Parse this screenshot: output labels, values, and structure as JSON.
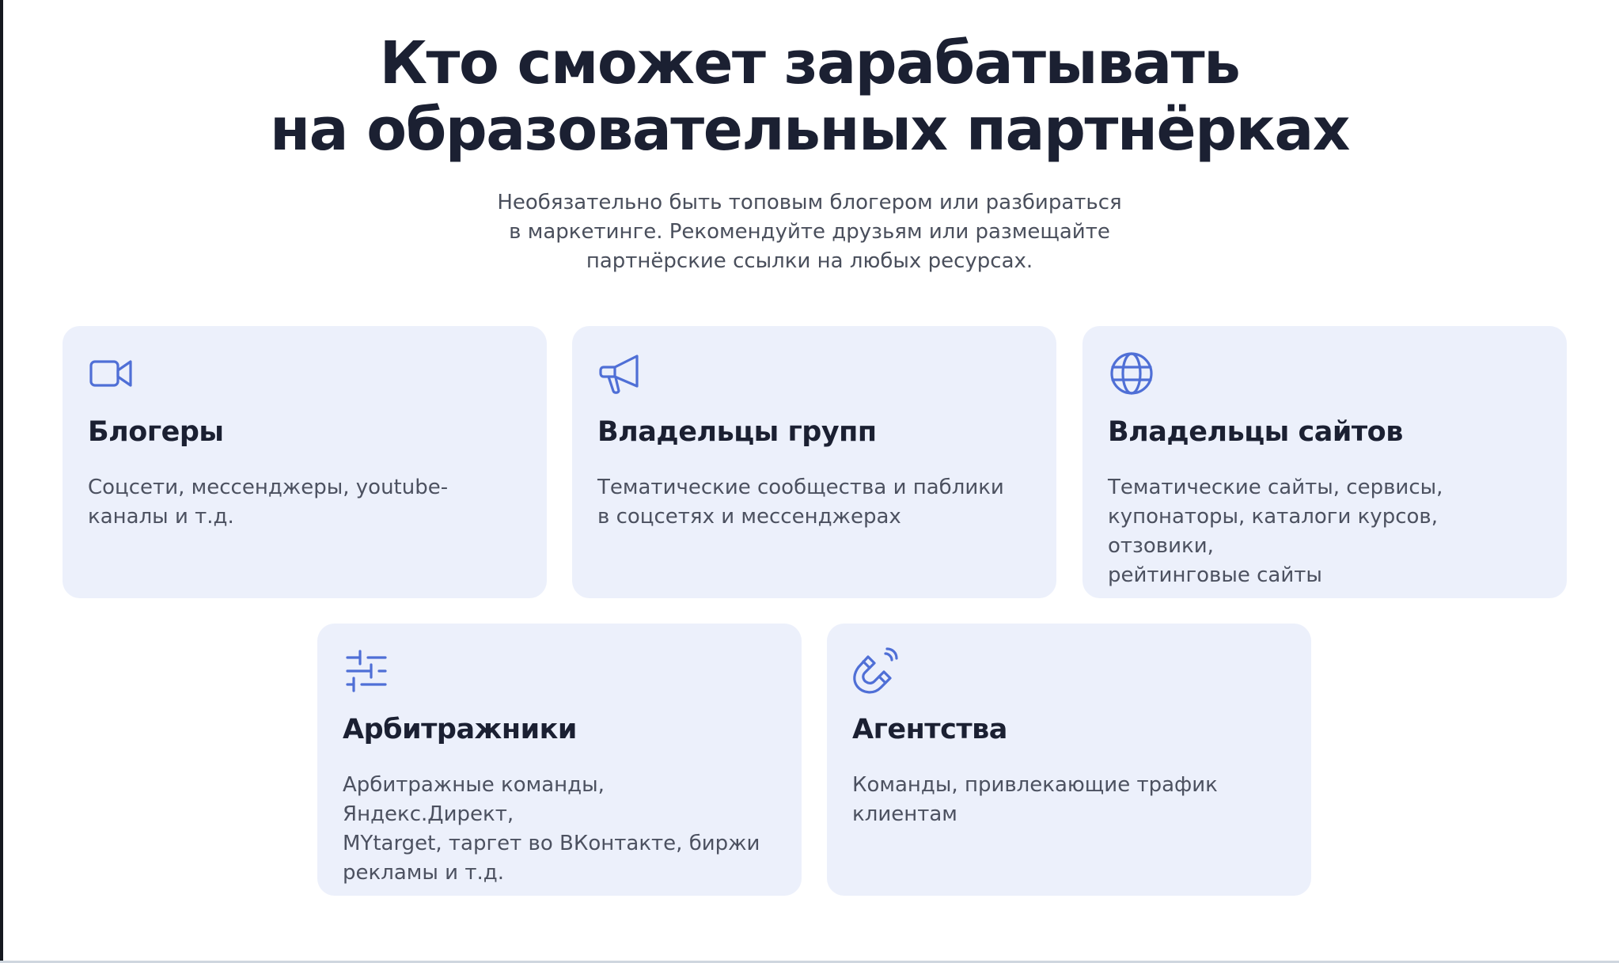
{
  "heading": {
    "line1": "Кто сможет зарабатывать",
    "line2": "на образовательных партнёрках"
  },
  "subtitle": {
    "line1": "Необязательно быть топовым блогером или разбираться",
    "line2": "в маркетинге. Рекомендуйте друзьям или размещайте",
    "line3": "партнёрские ссылки на любых ресурсах."
  },
  "colors": {
    "card_bg": "#ecf0fb",
    "icon": "#4f6fd6",
    "heading": "#1b2032",
    "body_text": "#4c5160"
  },
  "cards": [
    {
      "icon": "video-camera-icon",
      "title": "Блогеры",
      "text": [
        "Соцсети, мессенджеры, youtube-",
        "каналы и т.д."
      ]
    },
    {
      "icon": "megaphone-icon",
      "title": "Владельцы групп",
      "text": [
        "Тематические сообщества и паблики",
        "в соцсетях и мессенджерах"
      ]
    },
    {
      "icon": "globe-icon",
      "title": "Владельцы сайтов",
      "text": [
        "Тематические сайты, сервисы,",
        "купонаторы, каталоги курсов, отзовики,",
        "рейтинговые сайты"
      ]
    },
    {
      "icon": "sliders-icon",
      "title": "Арбитражники",
      "text": [
        "Арбитражные команды, Яндекс.Директ,",
        "MYtarget, таргет во ВКонтакте, биржи",
        "рекламы и т.д."
      ]
    },
    {
      "icon": "magnet-icon",
      "title": "Агентства",
      "text": [
        "Команды, привлекающие трафик",
        "клиентам"
      ]
    }
  ]
}
